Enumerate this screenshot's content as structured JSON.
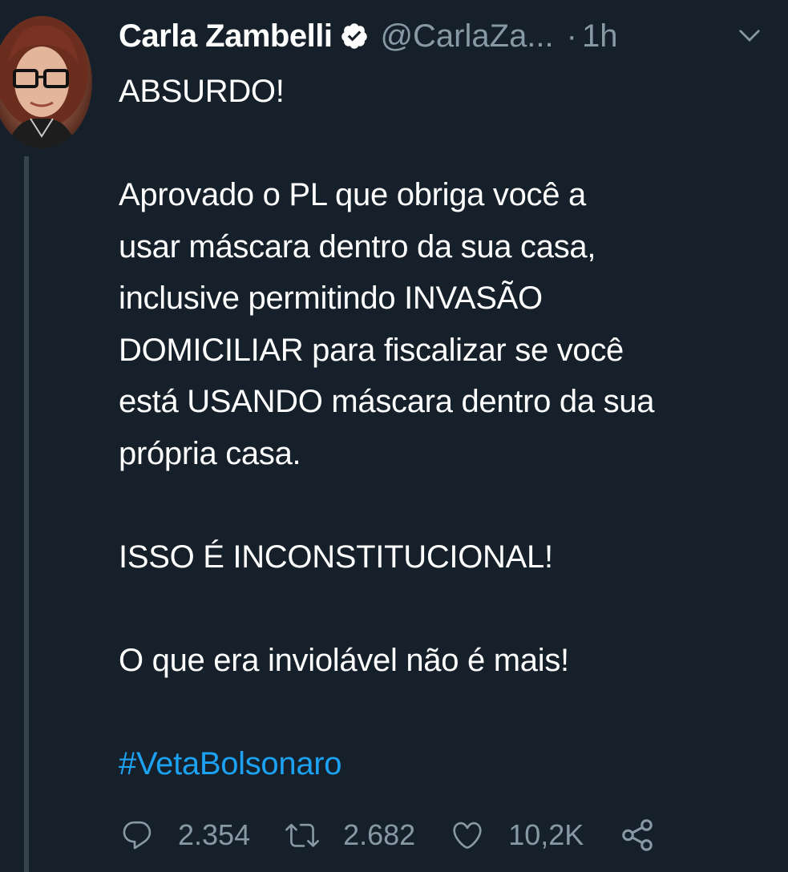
{
  "author": {
    "display_name": "Carla Zambelli",
    "handle": "@CarlaZa...",
    "time_separator": "·",
    "time": "1h"
  },
  "tweet": {
    "lines": [
      "ABSURDO!",
      "",
      "Aprovado o PL que obriga você a\nusar máscara dentro da sua casa,\ninclusive permitindo INVASÃO\nDOMICILIAR para fiscalizar se você\nestá USANDO máscara dentro da sua\nprópria casa.",
      "",
      "ISSO É INCONSTITUCIONAL!",
      "",
      "O que era inviolável não é mais!",
      ""
    ],
    "hashtag": "#VetaBolsonaro"
  },
  "actions": {
    "replies": "2.354",
    "retweets": "2.682",
    "likes": "10,2K"
  },
  "colors": {
    "background": "#15202b",
    "text": "#ffffff",
    "secondary": "#8899a6",
    "link": "#1da1f2",
    "thread_line": "#38444d"
  },
  "icons": [
    "verified-icon",
    "chevron-down-icon",
    "reply-icon",
    "retweet-icon",
    "like-icon",
    "share-icon"
  ]
}
